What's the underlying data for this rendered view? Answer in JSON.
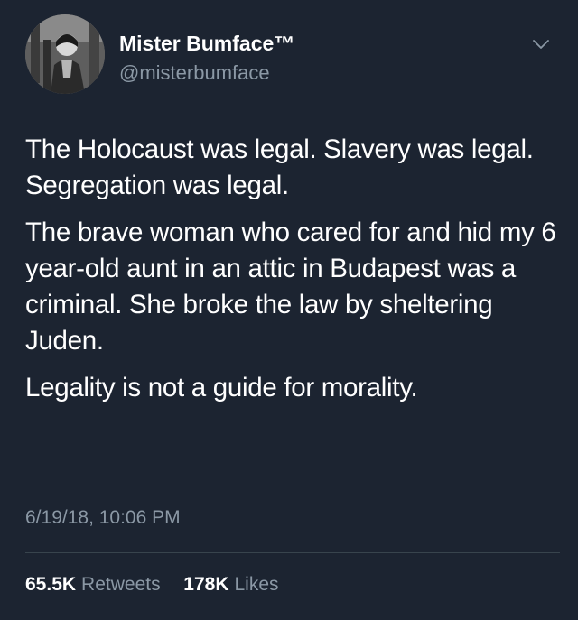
{
  "user": {
    "display_name": "Mister Bumface™",
    "handle": "@misterbumface"
  },
  "tweet": {
    "paragraphs": [
      "The Holocaust was legal. Slavery was legal. Segregation was legal.",
      "The brave woman who cared for and hid my 6 year-old aunt in an attic in Budapest was a criminal. She broke the law by sheltering Juden.",
      "Legality is not a guide for morality."
    ],
    "timestamp": "6/19/18, 10:06 PM"
  },
  "stats": {
    "retweets_count": "65.5K",
    "retweets_label": "Retweets",
    "likes_count": "178K",
    "likes_label": "Likes"
  },
  "colors": {
    "background": "#1c2431",
    "secondary_text": "#8b98a5",
    "divider": "#38444d"
  },
  "icons": {
    "menu": "chevron-down-icon"
  }
}
